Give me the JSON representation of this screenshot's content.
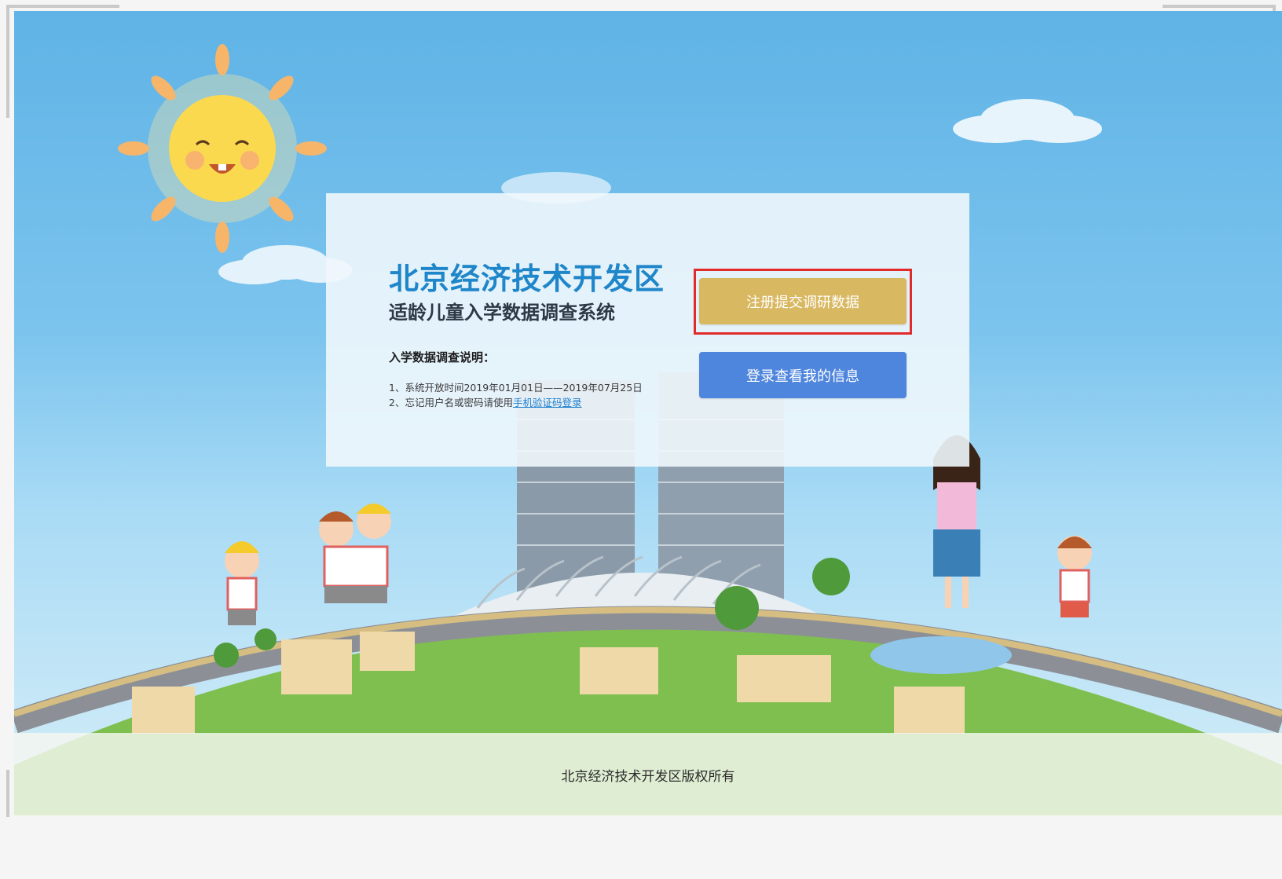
{
  "header": {
    "brand_title": "北京经济技术开发区",
    "system_title": "适龄儿童入学数据调查系统"
  },
  "notes": {
    "heading": "入学数据调查说明：",
    "line1": "1、系统开放时间2019年01月01日——2019年07月25日",
    "line2_prefix": "2、忘记用户名或密码请使用",
    "line2_link": "手机验证码登录"
  },
  "actions": {
    "register_label": "注册提交调研数据",
    "login_label": "登录查看我的信息"
  },
  "footer": {
    "copyright": "北京经济技术开发区版权所有"
  },
  "colors": {
    "brand_blue": "#1f86c9",
    "register_gold": "#d9b862",
    "login_blue": "#4f86dd",
    "highlight_red": "#e12a2a",
    "link_blue": "#1a7fd0"
  },
  "icons": {
    "sun": "sun-illustration",
    "cloud": "cloud-illustration",
    "buildings": "twin-towers-illustration",
    "children": "children-illustration",
    "teacher": "teacher-illustration"
  }
}
